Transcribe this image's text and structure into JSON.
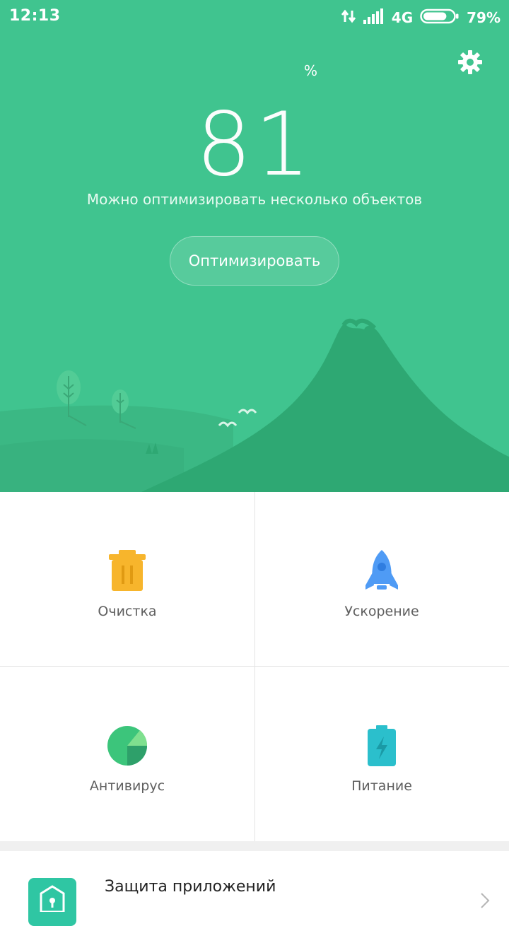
{
  "status_bar": {
    "time": "12:13",
    "network": "4G",
    "battery_percent": "79%",
    "battery_level": 0.79
  },
  "hero": {
    "score_value": "81",
    "score_unit": "%",
    "subtitle": "Можно оптимизировать несколько объектов",
    "optimize_label": "Оптимизировать",
    "background_color": "#40c48f"
  },
  "tiles": {
    "cleaner": {
      "label": "Очистка",
      "icon": "trash-icon",
      "color": "#f7b52c"
    },
    "boost": {
      "label": "Ускорение",
      "icon": "rocket-icon",
      "color": "#4f9bf5"
    },
    "antivirus": {
      "label": "Антивирус",
      "icon": "antivirus-icon",
      "color": "#3cc57b"
    },
    "battery": {
      "label": "Питание",
      "icon": "battery-icon",
      "color": "#2bbfcc"
    }
  },
  "list": {
    "app_lock": {
      "title": "Защита приложений",
      "icon": "app-lock-icon"
    }
  }
}
